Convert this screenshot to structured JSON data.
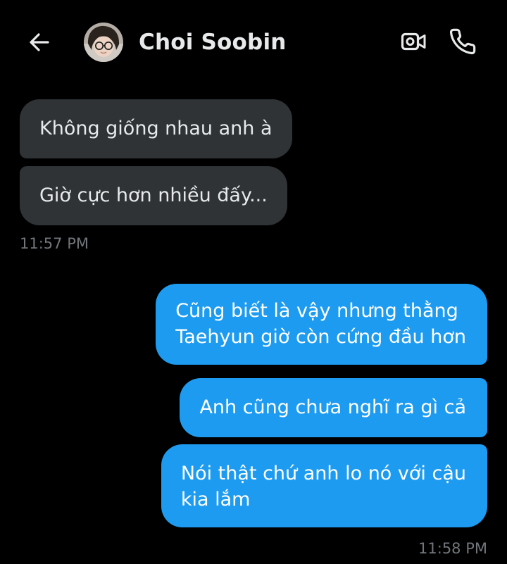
{
  "header": {
    "contact_name": "Choi Soobin",
    "back_icon": "arrow-left-icon",
    "video_icon": "video-camera-icon",
    "call_icon": "phone-icon"
  },
  "messages": [
    {
      "direction": "incoming",
      "lines": [
        "Không giống nhau anh à"
      ]
    },
    {
      "direction": "incoming",
      "lines": [
        "Giờ cực hơn nhiều đấy..."
      ]
    },
    {
      "direction": "outgoing",
      "lines": [
        "Cũng biết là vậy nhưng thằng",
        "Taehyun giờ còn cứng đầu hơn"
      ]
    },
    {
      "direction": "outgoing",
      "lines": [
        "Anh cũng chưa nghĩ ra gì cả"
      ]
    },
    {
      "direction": "outgoing",
      "lines": [
        "Nói thật chứ anh lo nó với cậu",
        "kia lắm"
      ]
    }
  ],
  "timestamps": {
    "incoming_group": "11:57 PM",
    "outgoing_group": "11:58 PM"
  },
  "colors": {
    "background": "#000000",
    "incoming_bubble": "#2f3336",
    "outgoing_bubble": "#1d9bf0",
    "timestamp": "#71767b"
  }
}
